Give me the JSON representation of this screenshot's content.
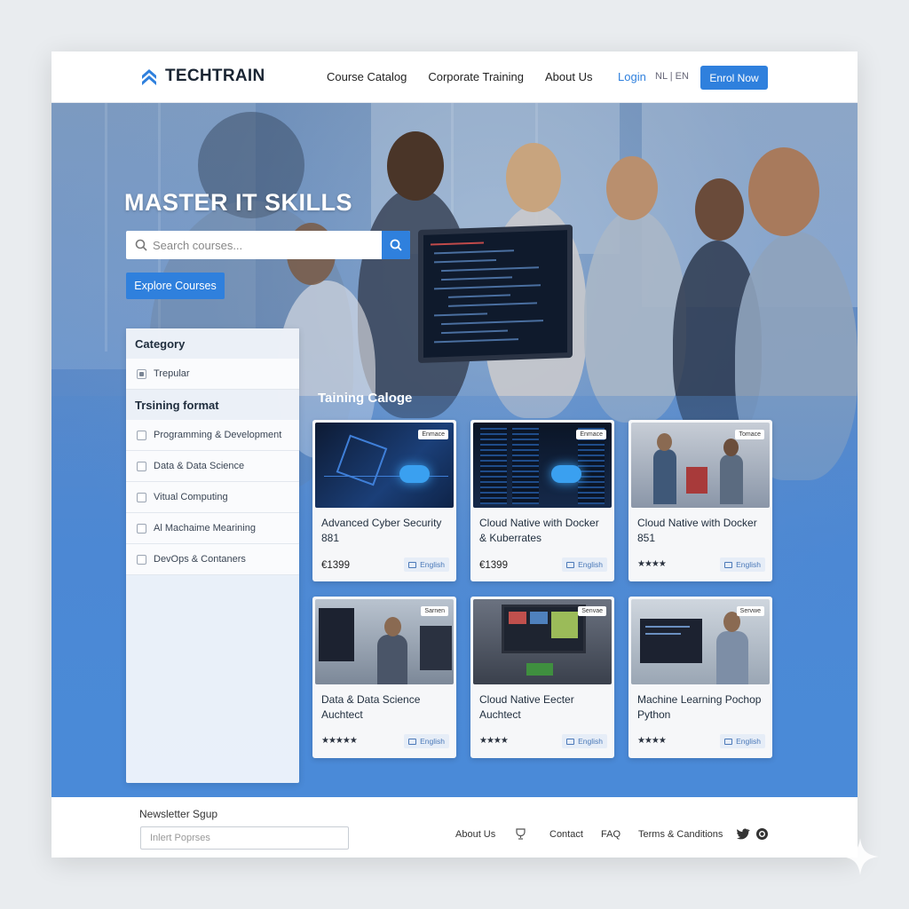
{
  "header": {
    "logo_text": "TECHTRAIN",
    "nav": [
      "Course Catalog",
      "Corporate Training",
      "About Us"
    ],
    "login_label": "Login",
    "language_switch": "NL | EN",
    "enroll_label": "Enrol Now"
  },
  "hero": {
    "title": "MASTER IT SKILLS",
    "search_placeholder": "Search courses...",
    "explore_label": "Explore Courses"
  },
  "sidebar": {
    "category_heading": "Category",
    "category_items": [
      {
        "label": "Trepular",
        "checked": true
      }
    ],
    "format_heading": "Trsining format",
    "format_items": [
      {
        "label": "Programming & Development",
        "checked": false
      },
      {
        "label": "Data & Data Science",
        "checked": false
      },
      {
        "label": "Vitual Computing",
        "checked": false
      },
      {
        "label": "Al Machaime Mearining",
        "checked": false
      },
      {
        "label": "DevOps & Contaners",
        "checked": false
      }
    ]
  },
  "catalog": {
    "title": "Taining Caloge",
    "courses": [
      {
        "tag": "Enmace",
        "title": "Advanced Cyber Security 881",
        "price": "€1399",
        "stars": "",
        "language": "English",
        "image": "cyber-security-chip"
      },
      {
        "tag": "Enmace",
        "title": "Cloud Native with Docker & Kuberrates",
        "price": "€1399",
        "stars": "",
        "language": "English",
        "image": "cloud-server-racks"
      },
      {
        "tag": "Tomace",
        "title": "Cloud Native with Docker 851",
        "price": "",
        "stars": "★★★★",
        "language": "English",
        "image": "office-workers"
      },
      {
        "tag": "Sarnen",
        "title": "Data & Data Science Auchtect",
        "price": "",
        "stars": "★★★★★",
        "language": "English",
        "image": "man-at-monitors"
      },
      {
        "tag": "Senvae",
        "title": "Cloud Native Eecter Auchtect",
        "price": "",
        "stars": "★★★★",
        "language": "English",
        "image": "lab-monitor"
      },
      {
        "tag": "Servwe",
        "title": "Machine Learning Pochop Python",
        "price": "",
        "stars": "★★★★",
        "language": "English",
        "image": "coder-at-desk"
      }
    ]
  },
  "footer": {
    "newsletter_title": "Newsletter Sgup",
    "newsletter_placeholder": "Inlert Poprses",
    "links": [
      "About Us",
      "Contact",
      "FAQ",
      "Terms & Canditions"
    ],
    "icons": [
      "trophy-icon",
      "twitter-icon",
      "instagram-icon"
    ]
  },
  "colors": {
    "accent": "#2f80dd",
    "hero": "#4a8ad8"
  }
}
